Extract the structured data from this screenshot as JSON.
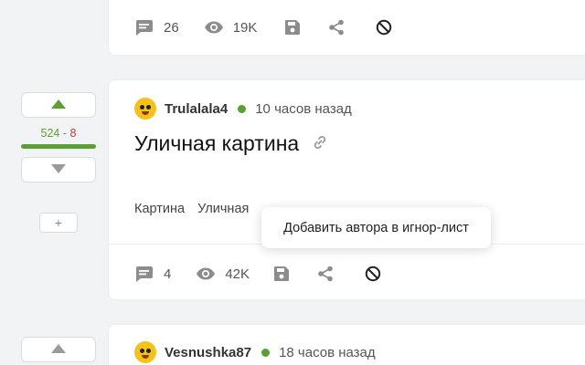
{
  "posts": [
    {
      "comments": "26",
      "views": "19K"
    },
    {
      "author": "Trulalala4",
      "time": "10 часов назад",
      "title": "Уличная картина",
      "tags": [
        "Картина",
        "Уличная"
      ],
      "rating_plus": "524",
      "rating_sep": "-",
      "rating_minus": "8",
      "comments": "4",
      "views": "42K",
      "add_label": "+"
    },
    {
      "author": "Vesnushka87",
      "time": "18 часов назад"
    }
  ],
  "tooltip": {
    "text": "Добавить автора в игнор-лист"
  },
  "icons": {
    "comment": "comment-icon",
    "views": "eye-icon",
    "save": "save-icon",
    "share": "share-icon",
    "ignore": "block-icon",
    "link": "link-icon",
    "upvote": "arrow-up-icon",
    "downvote": "arrow-down-icon"
  },
  "colors": {
    "online": "#5aa032",
    "rating_plus": "#5aa032",
    "rating_minus": "#c23b3b",
    "icon": "#888888"
  }
}
